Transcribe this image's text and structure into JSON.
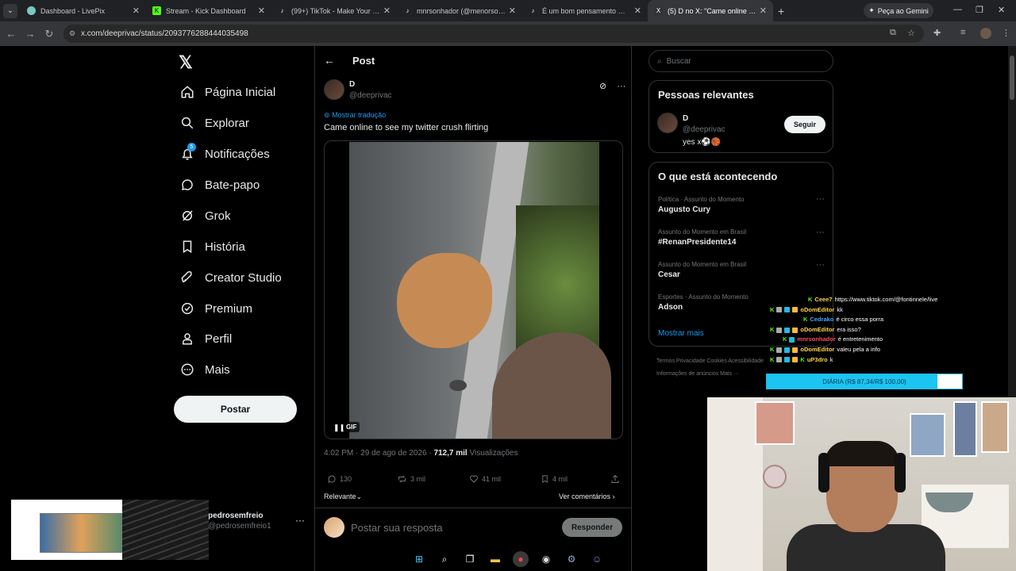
{
  "browser": {
    "tabs": [
      {
        "title": "Dashboard - LivePix",
        "color": "#7cc7c0"
      },
      {
        "title": "Stream - Kick Dashboard",
        "color": "#53fc18"
      },
      {
        "title": "(99+) TikTok - Make Your Day",
        "color": "#222"
      },
      {
        "title": "mnrsonhador (@menorsonhador)",
        "color": "#222"
      },
      {
        "title": "É um bom pensamento — legenda",
        "color": "#222"
      },
      {
        "title": "(5) D no X: \"Came online to see my",
        "color": "#333"
      }
    ],
    "gemini_label": "Peça ao Gemini",
    "url": "x.com/deeprivac/status/2093776288444035498"
  },
  "nav": {
    "logo": "𝕏",
    "notif_badge": "5",
    "items": [
      {
        "label": "Página Inicial"
      },
      {
        "label": "Explorar"
      },
      {
        "label": "Notificações"
      },
      {
        "label": "Bate-papo"
      },
      {
        "label": "Grok"
      },
      {
        "label": "História"
      },
      {
        "label": "Creator Studio"
      },
      {
        "label": "Premium"
      },
      {
        "label": "Perfil"
      },
      {
        "label": "Mais"
      }
    ],
    "post_button": "Postar",
    "account": {
      "name": "pedrosemfreio",
      "handle": "@pedrosemfreio1"
    }
  },
  "post": {
    "header": "Post",
    "author_name": "D",
    "author_handle": "@deeprivac",
    "translate": "Mostrar tradução",
    "text": "Came online to see my twitter crush flirting",
    "gif_label": "GIF",
    "time": "4:02 PM · 29 de ago de 2026 · ",
    "views_count": "712,7 mil",
    "views_label": " Visualizações",
    "replies": "130",
    "reposts": "3 mil",
    "likes": "41 mil",
    "bookmarks": "4 mil",
    "relevant": "Relevante",
    "see_comments": "Ver comentários",
    "reply_placeholder": "Postar sua resposta",
    "reply_button": "Responder"
  },
  "sidebar": {
    "search_placeholder": "Buscar",
    "people_title": "Pessoas relevantes",
    "person": {
      "name": "D",
      "handle": "@deeprivac",
      "bio": "yes x⚽🏀",
      "follow": "Seguir"
    },
    "trends_title": "O que está acontecendo",
    "trends": [
      {
        "context": "Política · Assunto do Momento",
        "topic": "Augusto Cury"
      },
      {
        "context": "Assunto do Momento em Brasil",
        "topic": "#RenanPresidente14"
      },
      {
        "context": "Assunto do Momento em Brasil",
        "topic": "Cesar"
      },
      {
        "context": "Esportes · Assunto do Momento",
        "topic": "Adson"
      }
    ],
    "show_more": "Mostrar mais",
    "footer1": "Termos    Privacidade    Cookies    Acessibilidade",
    "footer2": "Informações de anúncios    Mais ···"
  },
  "stream": {
    "chat": [
      {
        "user": "Ceee7",
        "msg": "https://www.tiktok.com/@fontinnele/live",
        "color": "#ffd54a"
      },
      {
        "user": "oDomEditor",
        "msg": "kk",
        "color": "#ffd54a"
      },
      {
        "user": "Cedrako",
        "msg": "é circo essa porra",
        "color": "#4aa3ff"
      },
      {
        "user": "oDomEditor",
        "msg": "era isso?",
        "color": "#ffd54a"
      },
      {
        "user": "mnrsonhador",
        "msg": "é entretenimento",
        "color": "#ff4a6a"
      },
      {
        "user": "oDomEditor",
        "msg": "valeu pela a info",
        "color": "#ffd54a"
      },
      {
        "user": "uP3dro",
        "msg": "k",
        "color": "#ffd54a"
      }
    ],
    "goal_label": "DIÁRIA (R$ 87,34/R$ 100,00)",
    "goal_fraction": 0.8734
  },
  "colors": {
    "accent": "#1d9bf0",
    "bg": "#000000",
    "kick": "#53fc18"
  }
}
